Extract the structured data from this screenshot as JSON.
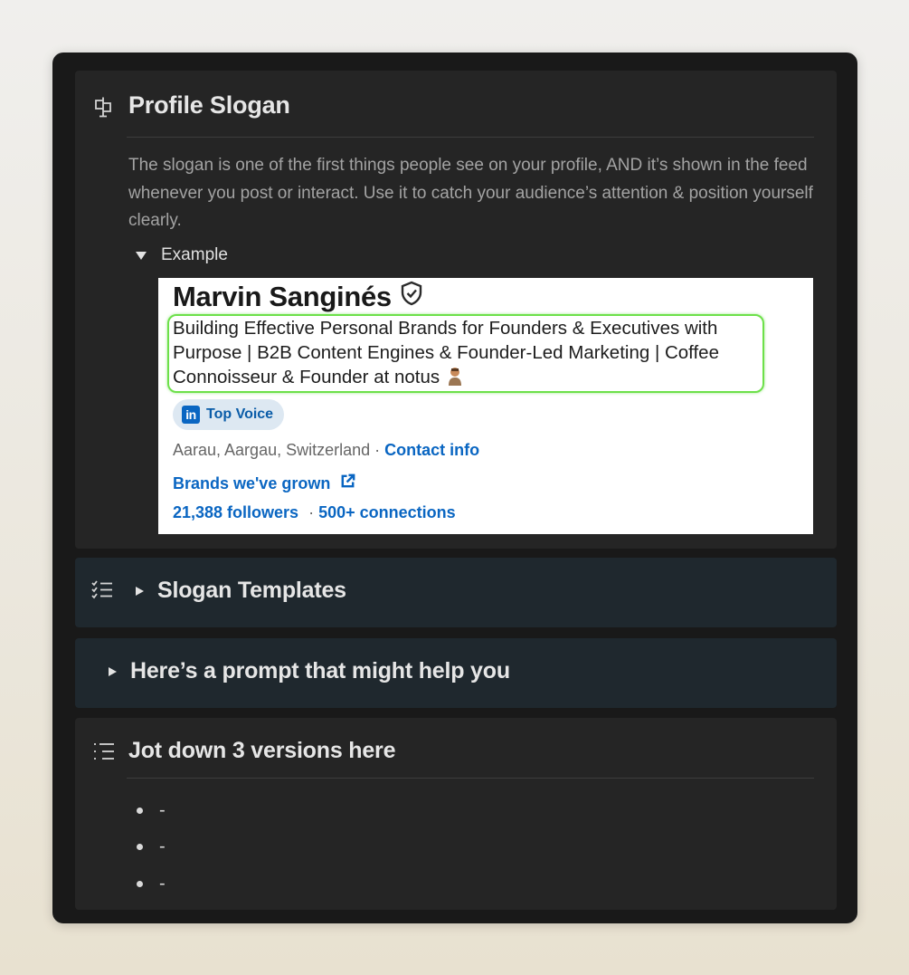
{
  "sections": {
    "profile_slogan": {
      "icon": "signpost-icon",
      "title": "Profile Slogan",
      "description": "The slogan is one of the first things people see on your profile, AND it’s shown in the feed whenever you post or interact. Use it to catch your audience’s attention & position yourself clearly.",
      "toggle_label": "Example",
      "example": {
        "name": "Marvin Sanginés",
        "headline": "Building Effective Personal Brands for Founders & Executives with Purpose | B2B Content Engines & Founder-Led Marketing | Coffee Connoisseur & Founder at notus",
        "badge_logo": "in",
        "badge": "Top Voice",
        "location": "Aarau, Aargau, Switzerland",
        "separator": "·",
        "contact_info": "Contact info",
        "brands_link": "Brands we've grown",
        "followers": "21,388 followers",
        "stats_separator": "·",
        "connections": "500+ connections",
        "link_color": "#0a66c2",
        "highlight_color": "#6de04a"
      }
    },
    "slogan_templates": {
      "icon": "checklist-icon",
      "title": "Slogan Templates"
    },
    "prompt": {
      "title": "Here’s a prompt that might help you"
    },
    "versions": {
      "icon": "list-icon",
      "title": "Jot down 3 versions here",
      "items": [
        "-",
        "-",
        "-"
      ]
    }
  }
}
